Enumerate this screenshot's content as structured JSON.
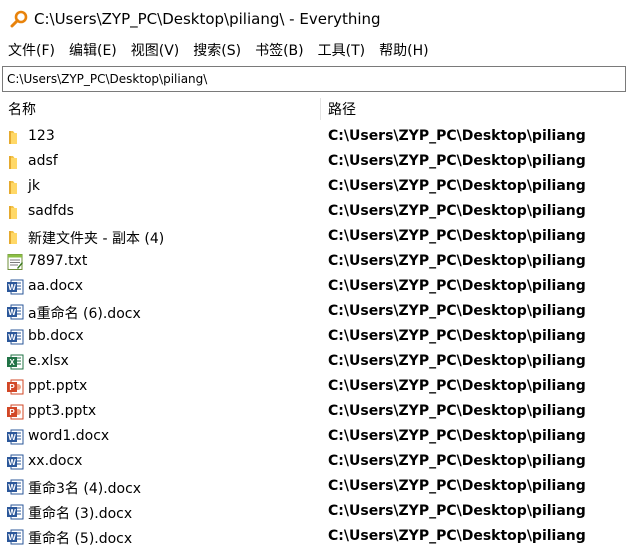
{
  "window": {
    "title": "C:\\Users\\ZYP_PC\\Desktop\\piliang\\  - Everything",
    "app_icon": "magnifier-icon",
    "accent_color": "#e8830c"
  },
  "menu": [
    {
      "label": "文件(F)"
    },
    {
      "label": "编辑(E)"
    },
    {
      "label": "视图(V)"
    },
    {
      "label": "搜索(S)"
    },
    {
      "label": "书签(B)"
    },
    {
      "label": "工具(T)"
    },
    {
      "label": "帮助(H)"
    }
  ],
  "search": {
    "value": "C:\\Users\\ZYP_PC\\Desktop\\piliang\\ "
  },
  "columns": {
    "name": "名称",
    "path": "路径"
  },
  "files": [
    {
      "name": "123",
      "path": "C:\\Users\\ZYP_PC\\Desktop\\piliang",
      "icon": "folder-icon"
    },
    {
      "name": "adsf",
      "path": "C:\\Users\\ZYP_PC\\Desktop\\piliang",
      "icon": "folder-icon"
    },
    {
      "name": "jk",
      "path": "C:\\Users\\ZYP_PC\\Desktop\\piliang",
      "icon": "folder-icon"
    },
    {
      "name": "sadfds",
      "path": "C:\\Users\\ZYP_PC\\Desktop\\piliang",
      "icon": "folder-icon"
    },
    {
      "name": "新建文件夹 - 副本 (4)",
      "path": "C:\\Users\\ZYP_PC\\Desktop\\piliang",
      "icon": "folder-icon"
    },
    {
      "name": "7897.txt",
      "path": "C:\\Users\\ZYP_PC\\Desktop\\piliang",
      "icon": "text-file-icon"
    },
    {
      "name": "aa.docx",
      "path": "C:\\Users\\ZYP_PC\\Desktop\\piliang",
      "icon": "word-file-icon"
    },
    {
      "name": "a重命名 (6).docx",
      "path": "C:\\Users\\ZYP_PC\\Desktop\\piliang",
      "icon": "word-file-icon"
    },
    {
      "name": "bb.docx",
      "path": "C:\\Users\\ZYP_PC\\Desktop\\piliang",
      "icon": "word-file-icon"
    },
    {
      "name": "e.xlsx",
      "path": "C:\\Users\\ZYP_PC\\Desktop\\piliang",
      "icon": "excel-file-icon"
    },
    {
      "name": "ppt.pptx",
      "path": "C:\\Users\\ZYP_PC\\Desktop\\piliang",
      "icon": "powerpoint-file-icon"
    },
    {
      "name": "ppt3.pptx",
      "path": "C:\\Users\\ZYP_PC\\Desktop\\piliang",
      "icon": "powerpoint-file-icon"
    },
    {
      "name": "word1.docx",
      "path": "C:\\Users\\ZYP_PC\\Desktop\\piliang",
      "icon": "word-file-icon"
    },
    {
      "name": "xx.docx",
      "path": "C:\\Users\\ZYP_PC\\Desktop\\piliang",
      "icon": "word-file-icon"
    },
    {
      "name": "重命3名 (4).docx",
      "path": "C:\\Users\\ZYP_PC\\Desktop\\piliang",
      "icon": "word-file-icon"
    },
    {
      "name": "重命名 (3).docx",
      "path": "C:\\Users\\ZYP_PC\\Desktop\\piliang",
      "icon": "word-file-icon"
    },
    {
      "name": "重命名 (5).docx",
      "path": "C:\\Users\\ZYP_PC\\Desktop\\piliang",
      "icon": "word-file-icon"
    }
  ]
}
